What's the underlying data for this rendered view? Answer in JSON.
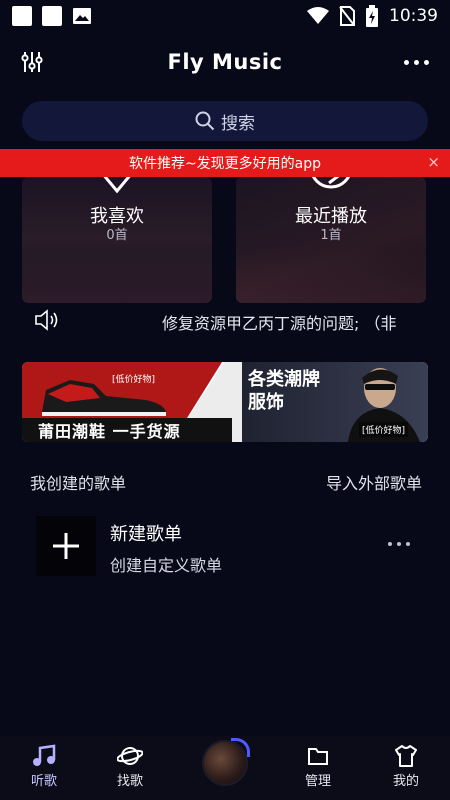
{
  "status_bar": {
    "time": "10:39"
  },
  "header": {
    "title": "Fly Music"
  },
  "search": {
    "placeholder": "搜索"
  },
  "promo_banner": {
    "text": "软件推荐~发现更多好用的app",
    "close": "×"
  },
  "cards": [
    {
      "title": "我喜欢",
      "count": "0首"
    },
    {
      "title": "最近播放",
      "count": "1首"
    }
  ],
  "notice": {
    "text": "修复资源甲乙丙丁源的问题; （非"
  },
  "ad": {
    "tag_left": "[低价好物]",
    "bottom_left": "莆田潮鞋  一手货源",
    "headline_line1": "各类潮牌",
    "headline_line2": "服饰",
    "tag_right": "[低价好物]"
  },
  "sections": {
    "my_playlists": "我创建的歌单",
    "import": "导入外部歌单"
  },
  "playlist": {
    "name": "新建歌单",
    "subtitle": "创建自定义歌单"
  },
  "bottom_nav": [
    {
      "label": "听歌",
      "icon": "music-note-icon",
      "active": true
    },
    {
      "label": "找歌",
      "icon": "planet-icon",
      "active": false
    },
    {
      "label": "管理",
      "icon": "folder-icon",
      "active": false
    },
    {
      "label": "我的",
      "icon": "tshirt-icon",
      "active": false
    }
  ],
  "colors": {
    "background": "#070818",
    "accent": "#4d5cff",
    "banner_red": "#e51b1b"
  }
}
